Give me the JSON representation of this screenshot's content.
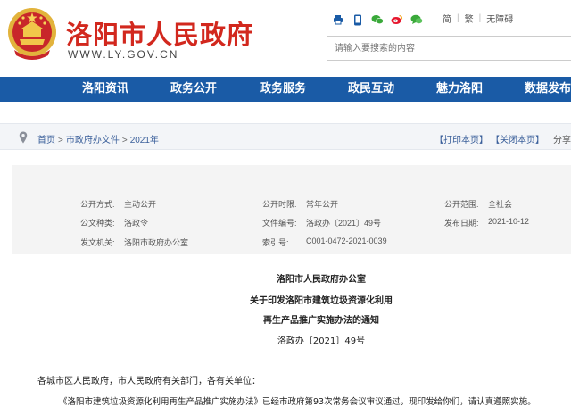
{
  "header": {
    "site_title": "洛阳市人民政府",
    "site_url": "WWW.LY.GOV.CN",
    "emblem_name": "national-emblem",
    "tool_icons": [
      "print-icon",
      "mobile-icon",
      "wechat-icon",
      "weibo-icon",
      "chat-icon"
    ],
    "links": [
      "简",
      "繁",
      "无障碍"
    ],
    "search_placeholder": "请输入要搜索的内容"
  },
  "nav": {
    "items": [
      "洛阳资讯",
      "政务公开",
      "政务服务",
      "政民互动",
      "魅力洛阳",
      "数据发布"
    ]
  },
  "breadcrumb": {
    "items": [
      "首页",
      "市政府办文件",
      "2021年"
    ],
    "separator": ">",
    "print": "【打印本页】",
    "close": "【关闭本页】",
    "share": "分享："
  },
  "info": {
    "row1": {
      "label1": "公开方式:",
      "value1": "主动公开",
      "label2": "公开时限:",
      "value2": "常年公开",
      "label3": "公开范围:",
      "value3": "全社会"
    },
    "row2": {
      "label1": "公文种类:",
      "value1": "洛政令",
      "label2": "文件编号:",
      "value2": "洛政办〔2021〕49号",
      "label3": "发布日期:",
      "value3": "2021-10-12"
    },
    "row3": {
      "label1": "发文机关:",
      "value1": "洛阳市政府办公室",
      "label2": "索引号:",
      "value2": "C001-0472-2021-0039"
    }
  },
  "document": {
    "issuer": "洛阳市人民政府办公室",
    "title_line1": "关于印发洛阳市建筑垃圾资源化利用",
    "title_line2": "再生产品推广实施办法的通知",
    "doc_number": "洛政办〔2021〕49号",
    "salutation": "各城市区人民政府，市人民政府有关部门，各有关单位：",
    "paragraph1": "《洛阳市建筑垃圾资源化利用再生产品推广实施办法》已经市政府第93次常务会议审议通过，现印发给你们，请认真遵照实施。"
  },
  "colors": {
    "brand_red": "#d2281e",
    "nav_blue": "#1a5ba6",
    "link_blue": "#3a5f9a"
  }
}
